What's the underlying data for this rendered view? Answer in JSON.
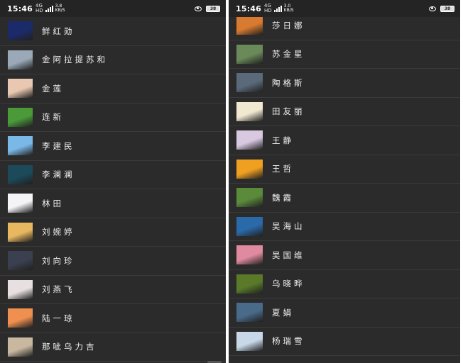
{
  "left_screen": {
    "status": {
      "time": "15:46",
      "signal_top": "4G",
      "signal_bottom": "HD",
      "net_top": "3.8",
      "net_bottom": "KB/S",
      "battery": "38"
    },
    "contacts": [
      {
        "name": "鲜红勋",
        "avatar": "wolf-silhouette-avatar",
        "color": "#1b2b6a"
      },
      {
        "name": "金阿拉提苏和",
        "avatar": "person-winter-avatar",
        "color": "#9aa8b8"
      },
      {
        "name": "金莲",
        "avatar": "hands-avatar",
        "color": "#e8c8b0"
      },
      {
        "name": "连新",
        "avatar": "green-field-avatar",
        "color": "#4a9a3a"
      },
      {
        "name": "李建民",
        "avatar": "pink-sky-avatar",
        "color": "#7ab8e8"
      },
      {
        "name": "李澜澜",
        "avatar": "sunset-figure-avatar",
        "color": "#1c4a5a"
      },
      {
        "name": "林田",
        "avatar": "blank-avatar",
        "color": "#f4f4f6"
      },
      {
        "name": "刘婉婷",
        "avatar": "anime-girl-avatar",
        "color": "#e8b860"
      },
      {
        "name": "刘向珍",
        "avatar": "dark-character-avatar",
        "color": "#3a4050"
      },
      {
        "name": "刘燕飞",
        "avatar": "cartoon-cat-avatar",
        "color": "#e8e0e0"
      },
      {
        "name": "陆一琼",
        "avatar": "orange-sunset-avatar",
        "color": "#f09050"
      },
      {
        "name": "那呲乌力吉",
        "avatar": "cat-avatar",
        "color": "#c8b8a0"
      }
    ]
  },
  "right_screen": {
    "status": {
      "time": "15:46",
      "signal_top": "4G",
      "signal_bottom": "HD",
      "net_top": "3.0",
      "net_bottom": "KB/S",
      "battery": "38"
    },
    "contacts": [
      {
        "name": "莎日娜",
        "avatar": "witch-cartoon-avatar",
        "color": "#d87a30"
      },
      {
        "name": "苏金星",
        "avatar": "car-field-avatar",
        "color": "#6a8a5a"
      },
      {
        "name": "陶格斯",
        "avatar": "rocky-river-avatar",
        "color": "#5a6a7a"
      },
      {
        "name": "田友丽",
        "avatar": "white-flower-avatar",
        "color": "#f0e8d0"
      },
      {
        "name": "王静",
        "avatar": "girl-drawing-avatar",
        "color": "#d8c8e0"
      },
      {
        "name": "王哲",
        "avatar": "goldfish-avatar",
        "color": "#f0a020"
      },
      {
        "name": "魏霞",
        "avatar": "grass-child-avatar",
        "color": "#5a8a3a"
      },
      {
        "name": "吴海山",
        "avatar": "blue-lake-avatar",
        "color": "#2a6aa8"
      },
      {
        "name": "吴国维",
        "avatar": "pink-child-avatar",
        "color": "#e08aa0"
      },
      {
        "name": "乌晓晔",
        "avatar": "flower-field-avatar",
        "color": "#5a7a2a"
      },
      {
        "name": "夏娟",
        "avatar": "mountain-lake-avatar",
        "color": "#4a6a8a"
      },
      {
        "name": "杨瑞雪",
        "avatar": "girl-circle-avatar",
        "color": "#c8d8e8"
      }
    ]
  }
}
